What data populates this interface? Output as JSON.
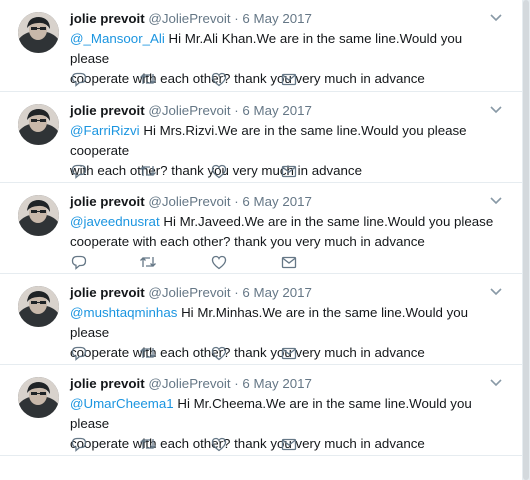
{
  "tweets": [
    {
      "name": "jolie prevoit",
      "handle": "@JoliePrevoit",
      "dot": "·",
      "date": "6 May 2017",
      "mention": "@_Mansoor_Ali",
      "text_line1": " Hi Mr.Ali Khan.We are in the same line.Would you please",
      "text_line2": "cooperate with each other? thank you very much in advance"
    },
    {
      "name": "jolie prevoit",
      "handle": "@JoliePrevoit",
      "dot": "·",
      "date": "6 May 2017",
      "mention": "@FarriRizvi",
      "text_line1": " Hi Mrs.Rizvi.We are in the same line.Would you please cooperate",
      "text_line2": "with each other? thank you very much in advance"
    },
    {
      "name": "jolie prevoit",
      "handle": "@JoliePrevoit",
      "dot": "·",
      "date": "6 May 2017",
      "mention": "@javeednusrat",
      "text_line1": " Hi Mr.Javeed.We are in the same line.Would you please",
      "text_line2": "cooperate with each other? thank you very much in advance"
    },
    {
      "name": "jolie prevoit",
      "handle": "@JoliePrevoit",
      "dot": "·",
      "date": "6 May 2017",
      "mention": "@mushtaqminhas",
      "text_line1": " Hi Mr.Minhas.We are in the same line.Would you please",
      "text_line2": "cooperate with each other? thank you very much in advance"
    },
    {
      "name": "jolie prevoit",
      "handle": "@JoliePrevoit",
      "dot": "·",
      "date": "6 May 2017",
      "mention": "@UmarCheema1",
      "text_line1": " Hi Mr.Cheema.We are in the same line.Would you please",
      "text_line2": "cooperate with each other? thank you very much in advance"
    }
  ],
  "icons": {
    "reply": "reply-icon",
    "retweet": "retweet-icon",
    "like": "heart-icon",
    "dm": "envelope-icon",
    "more": "chevron-down-icon"
  },
  "colors": {
    "mention": "#1b95e0",
    "secondary_text": "#657786",
    "border": "#e6ecf0"
  }
}
